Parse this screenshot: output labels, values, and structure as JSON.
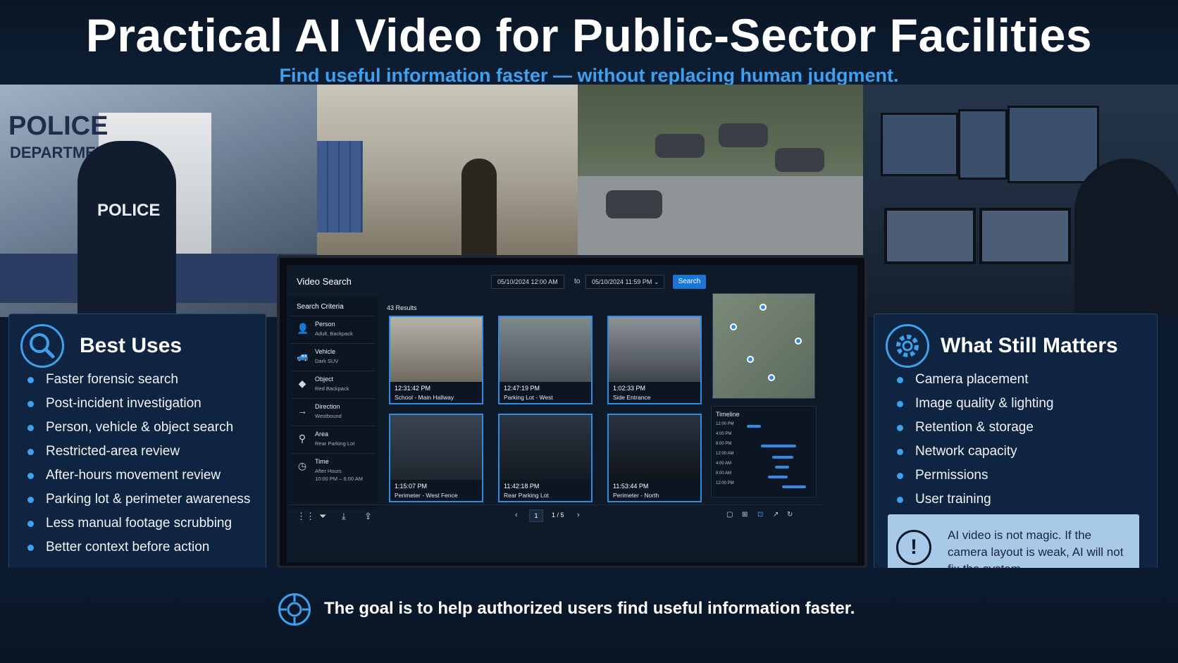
{
  "header": {
    "title": "Practical AI Video for Public-Sector Facilities",
    "subtitle": "Find useful information faster — without replacing human judgment."
  },
  "scene": {
    "wall_sign_line1": "POLICE",
    "wall_sign_line2": "DEPARTMENT",
    "vest_label": "POLICE"
  },
  "best_uses": {
    "title": "Best Uses",
    "icon": "search-icon",
    "items": [
      "Faster forensic search",
      "Post-incident investigation",
      "Person, vehicle & object search",
      "Restricted-area review",
      "After-hours movement review",
      "Parking lot & perimeter awareness",
      "Less manual footage scrubbing",
      "Better context before action"
    ]
  },
  "what_still_matters": {
    "title": "What Still Matters",
    "icon": "gear-icon",
    "items": [
      "Camera placement",
      "Image quality & lighting",
      "Retention & storage",
      "Network capacity",
      "Permissions",
      "User training"
    ],
    "callout_icon": "!",
    "callout_text": "AI video is not magic. If the camera layout is weak, AI will not fix the system."
  },
  "video_search": {
    "title": "Video Search",
    "date_from": "05/10/2024 12:00 AM",
    "date_sep": "to",
    "date_to": "05/10/2024 11:59 PM",
    "search_label": "Search",
    "criteria_title": "Search Criteria",
    "criteria": [
      {
        "name": "Person",
        "value": "Adult, Backpack",
        "icon": "person-icon"
      },
      {
        "name": "Vehicle",
        "value": "Dark SUV",
        "icon": "car-icon"
      },
      {
        "name": "Object",
        "value": "Red Backpack",
        "icon": "cube-icon"
      },
      {
        "name": "Direction",
        "value": "Westbound",
        "icon": "arrow-right-icon"
      },
      {
        "name": "Area",
        "value": "Rear Parking Lot",
        "icon": "map-pin-icon"
      },
      {
        "name": "Time",
        "value": "After Hours",
        "value2": "10:00 PM – 6:00 AM",
        "icon": "clock-icon"
      }
    ],
    "results_count": "43 Results",
    "results": [
      {
        "time": "12:31:42 PM",
        "location": "School - Main Hallway"
      },
      {
        "time": "12:47:19 PM",
        "location": "Parking Lot - West"
      },
      {
        "time": "1:02:33 PM",
        "location": "Side Entrance"
      },
      {
        "time": "1:15:07 PM",
        "location": "Perimeter - West Fence"
      },
      {
        "time": "11:42:18 PM",
        "location": "Rear Parking Lot"
      },
      {
        "time": "11:53:44 PM",
        "location": "Perimeter - North"
      }
    ],
    "timeline_title": "Timeline",
    "timeline_labels": [
      "12:00 PM",
      "4:00 PM",
      "8:00 PM",
      "12:00 AM",
      "4:00 AM",
      "8:00 AM",
      "12:00 PM"
    ],
    "page_current": "1",
    "page_text": "1 / 5"
  },
  "footer": {
    "text": "The goal is to help authorized users find useful information faster.",
    "icon": "crosshair-icon"
  },
  "colors": {
    "accent": "#3fa0ee",
    "background": "#0b1a2c",
    "panel": "#0f2440",
    "callout": "#a8c9e8"
  }
}
